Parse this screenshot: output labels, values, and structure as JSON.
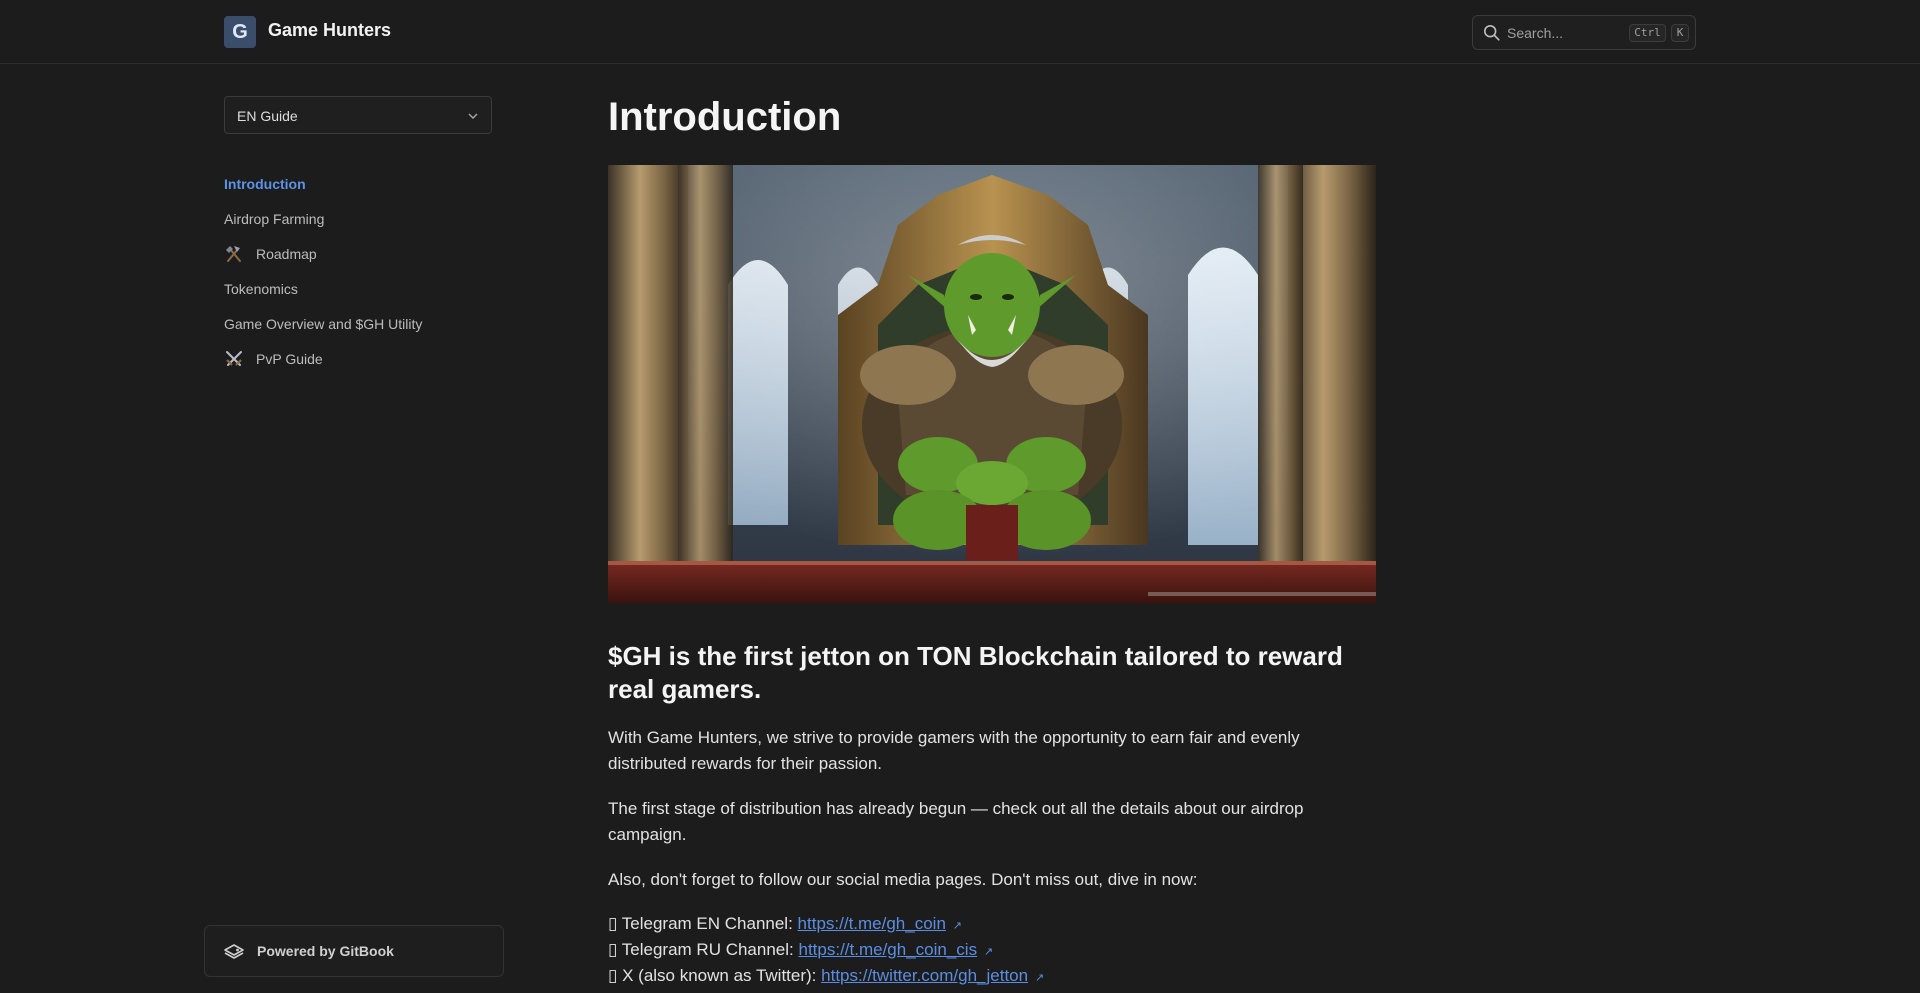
{
  "header": {
    "logo_letter": "G",
    "site_title": "Game Hunters",
    "search": {
      "label": "Search...",
      "shortcut_mod": "Ctrl",
      "shortcut_key": "K"
    }
  },
  "sidebar": {
    "space_selector": "EN Guide",
    "items": [
      {
        "label": "Introduction",
        "active": true
      },
      {
        "label": "Airdrop Farming"
      },
      {
        "label": "Roadmap",
        "icon": "hammer-pick-icon"
      },
      {
        "label": "Tokenomics"
      },
      {
        "label": "Game Overview and $GH Utility"
      },
      {
        "label": "PvP Guide",
        "icon": "crossed-swords-icon"
      }
    ],
    "powered_by": "Powered by GitBook"
  },
  "main": {
    "title": "Introduction",
    "hero_image": "orc-on-throne-illustration",
    "headline": "$GH is the first jetton on TON Blockchain tailored to reward real gamers.",
    "paragraphs": [
      "With Game Hunters, we strive to provide gamers with the opportunity to earn fair and evenly distributed rewards for their passion.",
      "The first stage of distribution has already begun — check out all the details about our airdrop campaign.",
      "Also, don't forget to follow our social media pages. Don't miss out, dive in now:"
    ],
    "links": [
      {
        "bullet": "▯",
        "label": "Telegram EN Channel: ",
        "url": "https://t.me/gh_coin"
      },
      {
        "bullet": "▯",
        "label": "Telegram RU Channel: ",
        "url": "https://t.me/gh_coin_cis"
      },
      {
        "bullet": "▯",
        "label": "X (also known as Twitter): ",
        "url": "https://twitter.com/gh_jetton"
      }
    ],
    "external_link_glyph": "↗"
  },
  "colors": {
    "background": "#1c1c1c",
    "accent": "#5d93e6",
    "link": "#5b8ee3"
  }
}
